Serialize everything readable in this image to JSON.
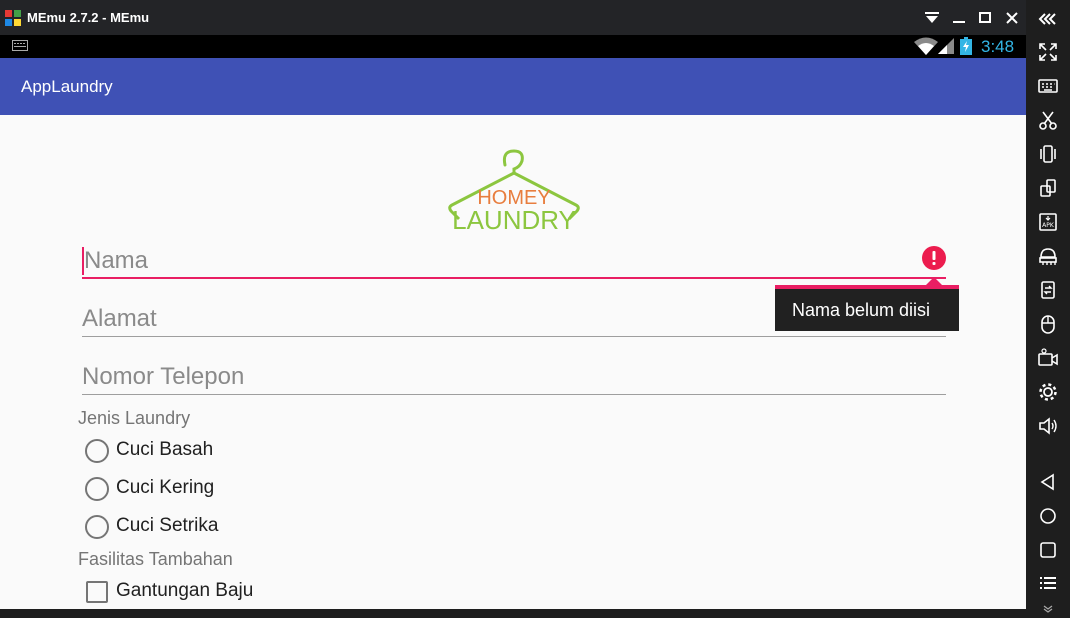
{
  "window": {
    "title": "MEmu 2.7.2 - MEmu",
    "controls": [
      "dropdown-icon",
      "minimize-icon",
      "maximize-icon",
      "close-icon",
      "collapse-sidebar-icon"
    ]
  },
  "statusbar": {
    "time": "3:48",
    "icons": [
      "keyboard-icon",
      "wifi-icon",
      "signal-icon",
      "battery-icon"
    ]
  },
  "app": {
    "title": "AppLaundry",
    "primary_color": "#3f51b5",
    "accent_color": "#e91e63"
  },
  "logo": {
    "line1": "HOMEY",
    "line2": "LAUNDRY",
    "hanger_color": "#8cc63f",
    "text_color": "#e87d3e"
  },
  "form": {
    "nama_placeholder": "Nama",
    "alamat_placeholder": "Alamat",
    "telepon_placeholder": "Nomor Telepon",
    "error_message": "Nama belum diisi",
    "jenis_label": "Jenis Laundry",
    "jenis_options": [
      "Cuci Basah",
      "Cuci Kering",
      "Cuci Setrika"
    ],
    "fasilitas_label": "Fasilitas Tambahan",
    "fasilitas_options": [
      "Gantungan Baju"
    ]
  },
  "sidebar": {
    "tools": [
      "fullscreen-icon",
      "keyboard-mapping-icon",
      "screenshot-icon",
      "shake-icon",
      "rotate-icon",
      "install-apk-icon",
      "android-icon",
      "sync-icon",
      "mouse-icon",
      "video-record-icon",
      "settings-icon",
      "volume-icon",
      "back-icon",
      "home-icon",
      "recents-icon",
      "menu-icon"
    ]
  }
}
